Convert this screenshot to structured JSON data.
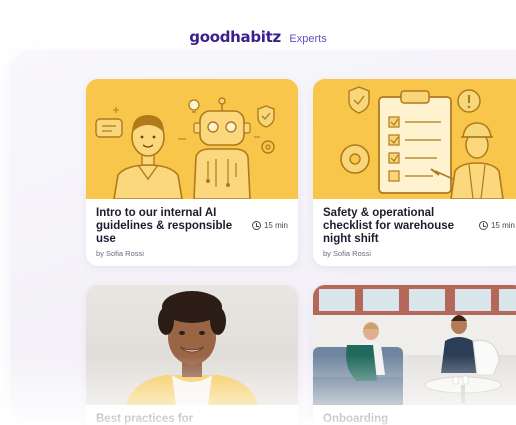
{
  "brand": {
    "logo": "goodhabitz",
    "suffix": "Experts",
    "color": "#3b1f8f"
  },
  "cards": [
    {
      "title": "Intro to our internal AI guidelines & responsible use",
      "author": "by Sofia Rossi",
      "duration": "15 min",
      "thumb_bg": "#f8c64a"
    },
    {
      "title": "Safety & operational checklist for warehouse night shift",
      "author": "by Sofia Rossi",
      "duration": "15 min",
      "thumb_bg": "#f8c64a"
    },
    {
      "title": "Best practices for",
      "author": "",
      "duration": ""
    },
    {
      "title": "Onboarding",
      "author": "",
      "duration": ""
    }
  ],
  "icons": {
    "clock": "clock-icon",
    "robot": "robot-icon",
    "clipboard": "clipboard-icon"
  }
}
